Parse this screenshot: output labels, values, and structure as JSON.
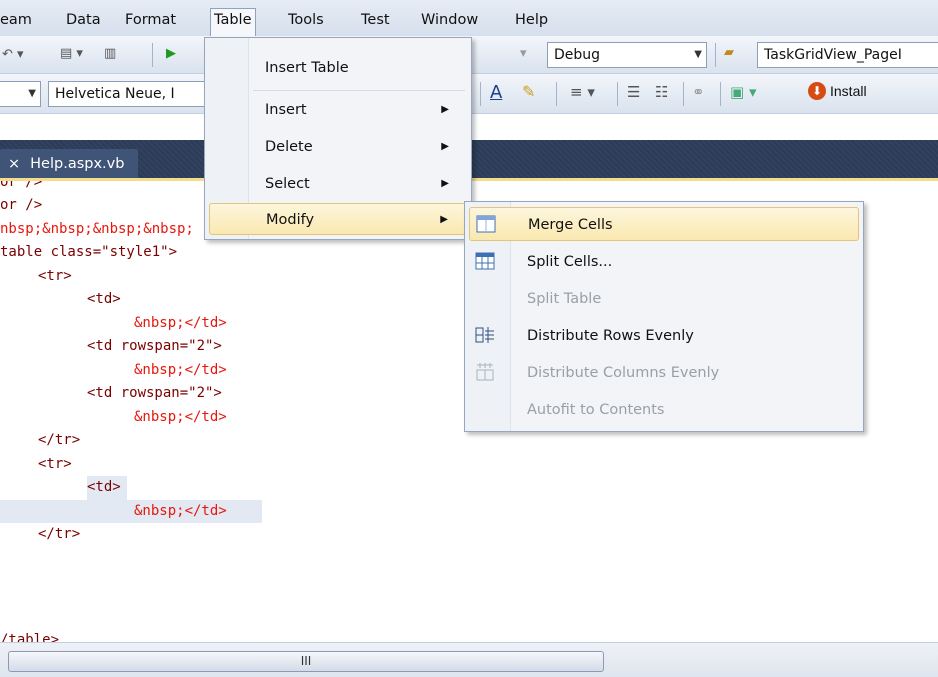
{
  "menubar": {
    "items": [
      {
        "label": "eam"
      },
      {
        "label": "Data"
      },
      {
        "label": "Format"
      },
      {
        "label": "Table"
      },
      {
        "label": "Tools"
      },
      {
        "label": "Test"
      },
      {
        "label": "Window"
      },
      {
        "label": "Help"
      }
    ],
    "active": "Table"
  },
  "toolbar": {
    "config_value": "Debug",
    "project_value": "TaskGridView_PageI",
    "font_value": "Helvetica Neue, I",
    "install_label": "Install"
  },
  "doc_tab": {
    "label": "Help.aspx.vb"
  },
  "code_lines": [
    {
      "text": "or />"
    },
    {
      "text": "or />"
    },
    {
      "text": "nbsp;&nbsp;&nbsp;&nbsp;"
    },
    {
      "text": "table class=\"style1\">"
    },
    {
      "text": "<tr>"
    },
    {
      "text": "<td>"
    },
    {
      "text": "&nbsp;</td>"
    },
    {
      "text": "<td rowspan=\"2\">"
    },
    {
      "text": "&nbsp;</td>"
    },
    {
      "text": "<td rowspan=\"2\">"
    },
    {
      "text": "&nbsp;</td>"
    },
    {
      "text": "</tr>"
    },
    {
      "text": "<tr>"
    },
    {
      "text": "<td>"
    },
    {
      "text": "&nbsp;</td>"
    },
    {
      "text": "</tr>"
    },
    {
      "text": "/table>"
    }
  ],
  "table_menu": {
    "items": [
      {
        "label": "Insert Table"
      },
      {
        "label": "Insert"
      },
      {
        "label": "Delete"
      },
      {
        "label": "Select"
      },
      {
        "label": "Modify"
      }
    ]
  },
  "modify_menu": {
    "items": [
      {
        "label": "Merge Cells",
        "enabled": true,
        "icon": "merge-cells-icon"
      },
      {
        "label": "Split Cells...",
        "enabled": true,
        "icon": "split-cells-icon"
      },
      {
        "label": "Split Table",
        "enabled": false,
        "icon": ""
      },
      {
        "label": "Distribute Rows Evenly",
        "enabled": true,
        "icon": "distribute-rows-icon"
      },
      {
        "label": "Distribute Columns Evenly",
        "enabled": false,
        "icon": "distribute-columns-icon"
      },
      {
        "label": "Autofit to Contents",
        "enabled": false,
        "icon": ""
      }
    ]
  },
  "scrollbar": {
    "thumb_grip": "III"
  },
  "colors": {
    "highlight": "#fae8b0",
    "tabstrip": "#2b3c59",
    "code_tag": "#7a0000",
    "code_attr": "#e8160c",
    "code_value": "#1a1ab4"
  }
}
